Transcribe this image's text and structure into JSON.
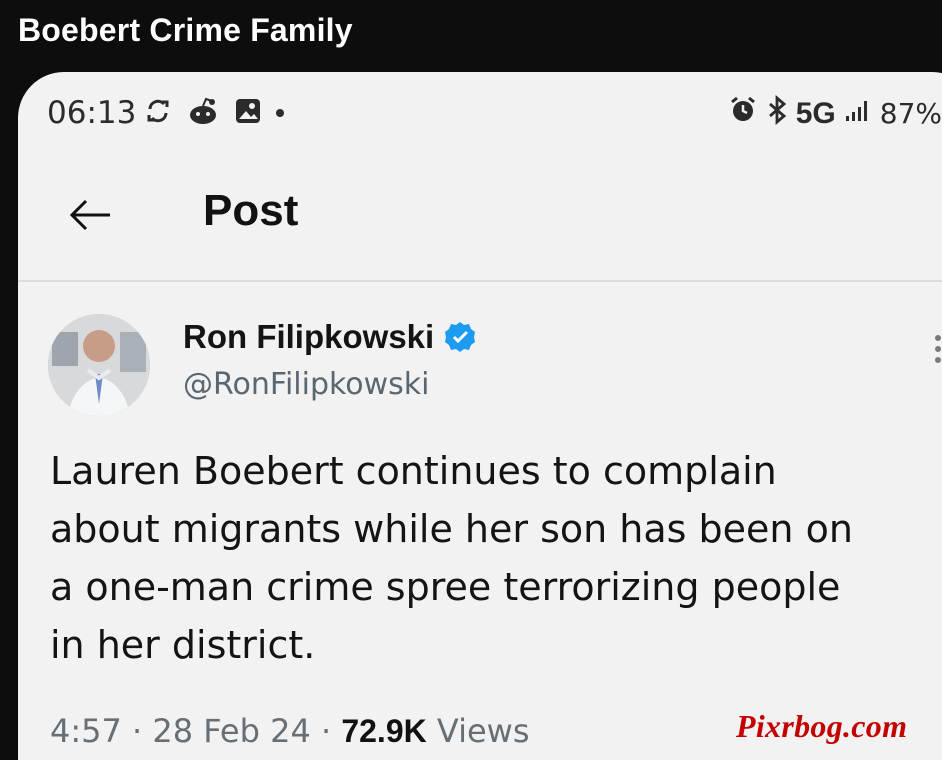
{
  "screen_title": "Boebert Crime Family",
  "status_bar": {
    "time": "06:13",
    "left_icons": [
      "sync-icon",
      "reddit-icon",
      "gallery-icon",
      "notification-dot-icon"
    ],
    "right_icons": [
      "alarm-icon",
      "bluetooth-icon",
      "signal-icon"
    ],
    "network": "5G",
    "battery": "87%"
  },
  "app_bar": {
    "back_icon": "back-arrow-icon",
    "title": "Post"
  },
  "post": {
    "author_name": "Ron Filipkowski",
    "author_handle": "@RonFilipkowski",
    "verified_icon": "verified-badge-icon",
    "text": "Lauren Boebert continues to complain\nabout migrants while her son has been on\na one-man crime spree terrorizing people\nin her district.",
    "meta": {
      "time": "4:57",
      "date": "28 Feb 24",
      "views_count": "72.9K",
      "views_label": "Views",
      "separator": "·"
    }
  },
  "watermark": "Pixrbog.com",
  "colors": {
    "background": "#0d0d0d",
    "phone_bg": "#f2f2f2",
    "verified_blue": "#1d9bf0",
    "watermark_red": "#c40000"
  }
}
